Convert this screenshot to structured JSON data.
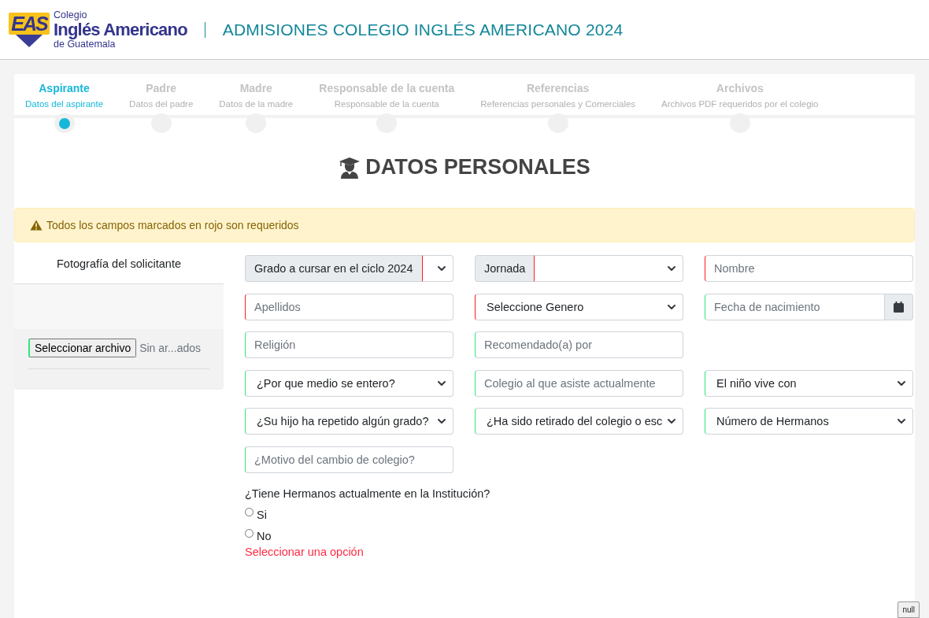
{
  "header": {
    "logo": {
      "mark": "EAS",
      "line1": "Colegio",
      "line2": "Inglés Americano",
      "line3": "de Guatemala"
    },
    "title": "ADMISIONES COLEGIO INGLÉS AMERICANO 2024"
  },
  "steps": [
    {
      "title": "Aspirante",
      "subtitle": "Datos del aspirante",
      "selected": true
    },
    {
      "title": "Padre",
      "subtitle": "Datos del padre",
      "selected": false
    },
    {
      "title": "Madre",
      "subtitle": "Datos de la madre",
      "selected": false
    },
    {
      "title": "Responsable de la cuenta",
      "subtitle": "Responsable de la cuenta",
      "selected": false
    },
    {
      "title": "Referencias",
      "subtitle": "Referencias personales y Comerciales",
      "selected": false
    },
    {
      "title": "Archivos",
      "subtitle": "Archivos PDF requeridos por el colegio",
      "selected": false
    }
  ],
  "section_title": "DATOS PERSONALES",
  "alert": "Todos los campos marcados en rojo son requeridos",
  "photo": {
    "title": "Fotografía del solicitante",
    "button": "Seleccionar archivo",
    "button_invalid": false,
    "file_status": "Sin ar...ados"
  },
  "field_rows": [
    [
      {
        "kind": "group-select",
        "label": "Grado a cursar en el ciclo 2024",
        "invalid": true
      },
      {
        "kind": "group-select",
        "label": "Jornada",
        "invalid": true
      },
      {
        "kind": "input",
        "placeholder": "Nombre",
        "invalid": true
      }
    ],
    [
      {
        "kind": "input",
        "placeholder": "Apellidos",
        "invalid": true
      },
      {
        "kind": "select",
        "value": "Seleccione Genero",
        "invalid": true
      },
      {
        "kind": "date",
        "placeholder": "Fecha de nacimiento",
        "invalid": false
      }
    ],
    [
      {
        "kind": "input",
        "placeholder": "Religión",
        "invalid": false
      },
      {
        "kind": "input",
        "placeholder": "Recomendado(a) por",
        "invalid": false
      }
    ],
    [
      {
        "kind": "select",
        "value": "¿Por que medio se entero?",
        "invalid": false
      },
      {
        "kind": "input",
        "placeholder": "Colegio al que asiste actualmente",
        "invalid": false
      },
      {
        "kind": "select",
        "value": "El niño vive con",
        "invalid": false
      }
    ],
    [
      {
        "kind": "select",
        "value": "¿Su hijo ha repetido algún grado?",
        "invalid": false
      },
      {
        "kind": "select",
        "value": "¿Ha sido retirado del colegio o esc",
        "invalid": false
      },
      {
        "kind": "select",
        "value": "Número de Hermanos",
        "invalid": false
      }
    ],
    [
      {
        "kind": "input",
        "placeholder": "¿Motivo del cambio de colegio?",
        "invalid": false
      }
    ]
  ],
  "siblings_question": {
    "question": "¿Tiene Hermanos actualmente en la Institución?",
    "options": [
      {
        "label": "Si",
        "selected": false
      },
      {
        "label": "No",
        "selected": false
      }
    ],
    "error": "Seleccionar una opción"
  },
  "corner_button": {
    "label": "null"
  }
}
